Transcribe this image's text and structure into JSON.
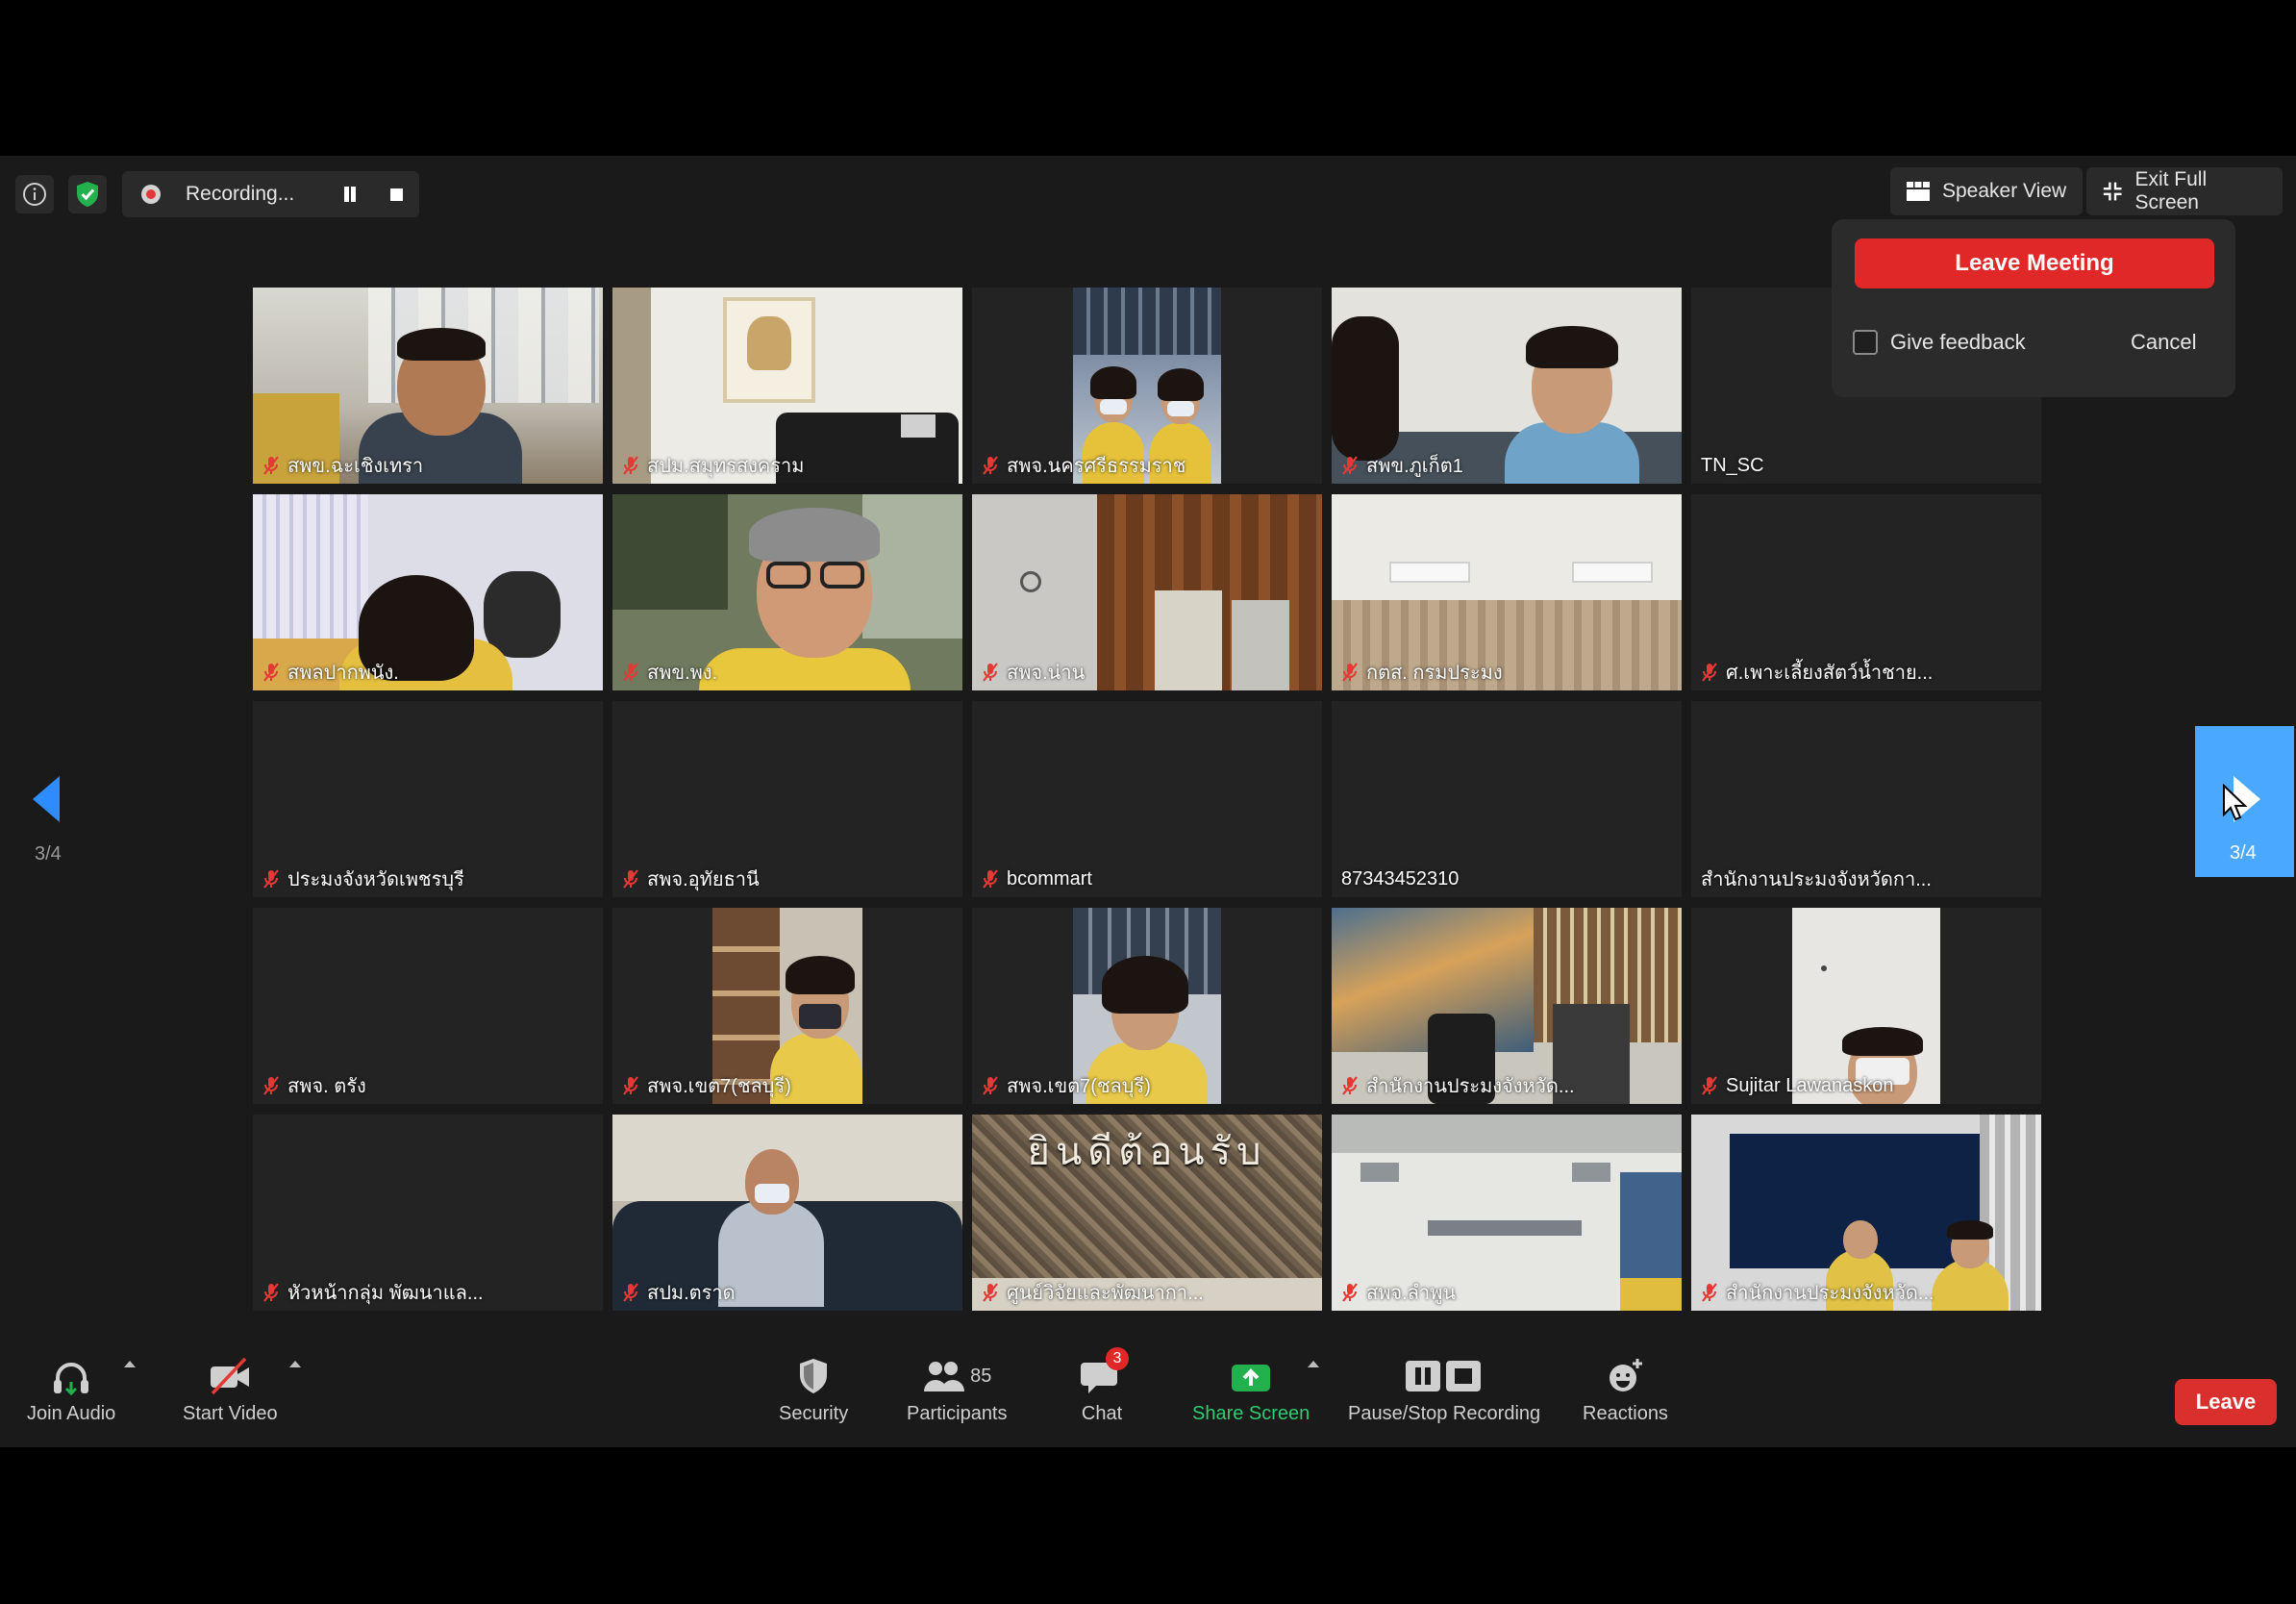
{
  "top_bar": {
    "recording_label": "Recording...",
    "speaker_view_label": "Speaker View",
    "exit_fullscreen_label": "Exit Full Screen"
  },
  "leave_popover": {
    "leave_meeting_label": "Leave Meeting",
    "feedback_label": "Give feedback",
    "feedback_checked": false,
    "cancel_label": "Cancel"
  },
  "gallery": {
    "page_indicator_left": "3/4",
    "page_indicator_right": "3/4",
    "tiles": [
      {
        "name": "สพข.ฉะเชิงเทรา",
        "muted": true,
        "video": true
      },
      {
        "name": "สปม.สมุทรสงคราม",
        "muted": true,
        "video": true
      },
      {
        "name": "สพจ.นครศรีธรรมราช",
        "muted": true,
        "video": true
      },
      {
        "name": "สพข.ภูเก็ต1",
        "muted": true,
        "video": true
      },
      {
        "name": "TN_SC",
        "muted": false,
        "video": false
      },
      {
        "name": "สพลปากพนัง.",
        "muted": true,
        "video": true
      },
      {
        "name": "สพข.พง.",
        "muted": true,
        "video": true
      },
      {
        "name": "สพจ.น่าน",
        "muted": true,
        "video": true
      },
      {
        "name": "กตส. กรมประมง",
        "muted": true,
        "video": true
      },
      {
        "name": "ศ.เพาะเลี้ยงสัตว์น้ำชาย...",
        "muted": true,
        "video": false
      },
      {
        "name": "ประมงจังหวัดเพชรบุรี",
        "muted": true,
        "video": false
      },
      {
        "name": "สพจ.อุทัยธานี",
        "muted": true,
        "video": false
      },
      {
        "name": "bcommart",
        "muted": true,
        "video": false
      },
      {
        "name": "87343452310",
        "muted": false,
        "video": false
      },
      {
        "name": "สำนักงานประมงจังหวัดกา...",
        "muted": false,
        "video": false
      },
      {
        "name": "สพจ. ตรัง",
        "muted": true,
        "video": false
      },
      {
        "name": "สพจ.เขต7(ชลบุรี)",
        "muted": true,
        "video": true
      },
      {
        "name": "สพจ.เขต7(ชลบุรี)",
        "muted": true,
        "video": true
      },
      {
        "name": "สำนักงานประมงจังหวัด...",
        "muted": true,
        "video": true
      },
      {
        "name": "Sujitar Lawanaskon",
        "muted": true,
        "video": true
      },
      {
        "name": "หัวหน้ากลุ่ม พัฒนาแล...",
        "muted": true,
        "video": false
      },
      {
        "name": "สปม.ตราด",
        "muted": true,
        "video": true
      },
      {
        "name": "ศูนย์วิจัยและพัฒนากา...",
        "muted": true,
        "video": true
      },
      {
        "name": "สพจ.ลำพูน",
        "muted": true,
        "video": true
      },
      {
        "name": "สำนักงานประมงจังหวัด...",
        "muted": true,
        "video": true
      }
    ],
    "welcome_sign_text": "ยินดีต้อนรับ"
  },
  "toolbar": {
    "join_audio_label": "Join Audio",
    "start_video_label": "Start Video",
    "security_label": "Security",
    "participants_label": "Participants",
    "participants_count": "85",
    "chat_label": "Chat",
    "chat_badge": "3",
    "share_screen_label": "Share Screen",
    "pause_stop_label": "Pause/Stop Recording",
    "reactions_label": "Reactions",
    "leave_label": "Leave"
  },
  "colors": {
    "accent_blue": "#2d8cff",
    "leave_red": "#e02828",
    "share_green": "#2ecc71",
    "background": "#1a1a1a"
  }
}
